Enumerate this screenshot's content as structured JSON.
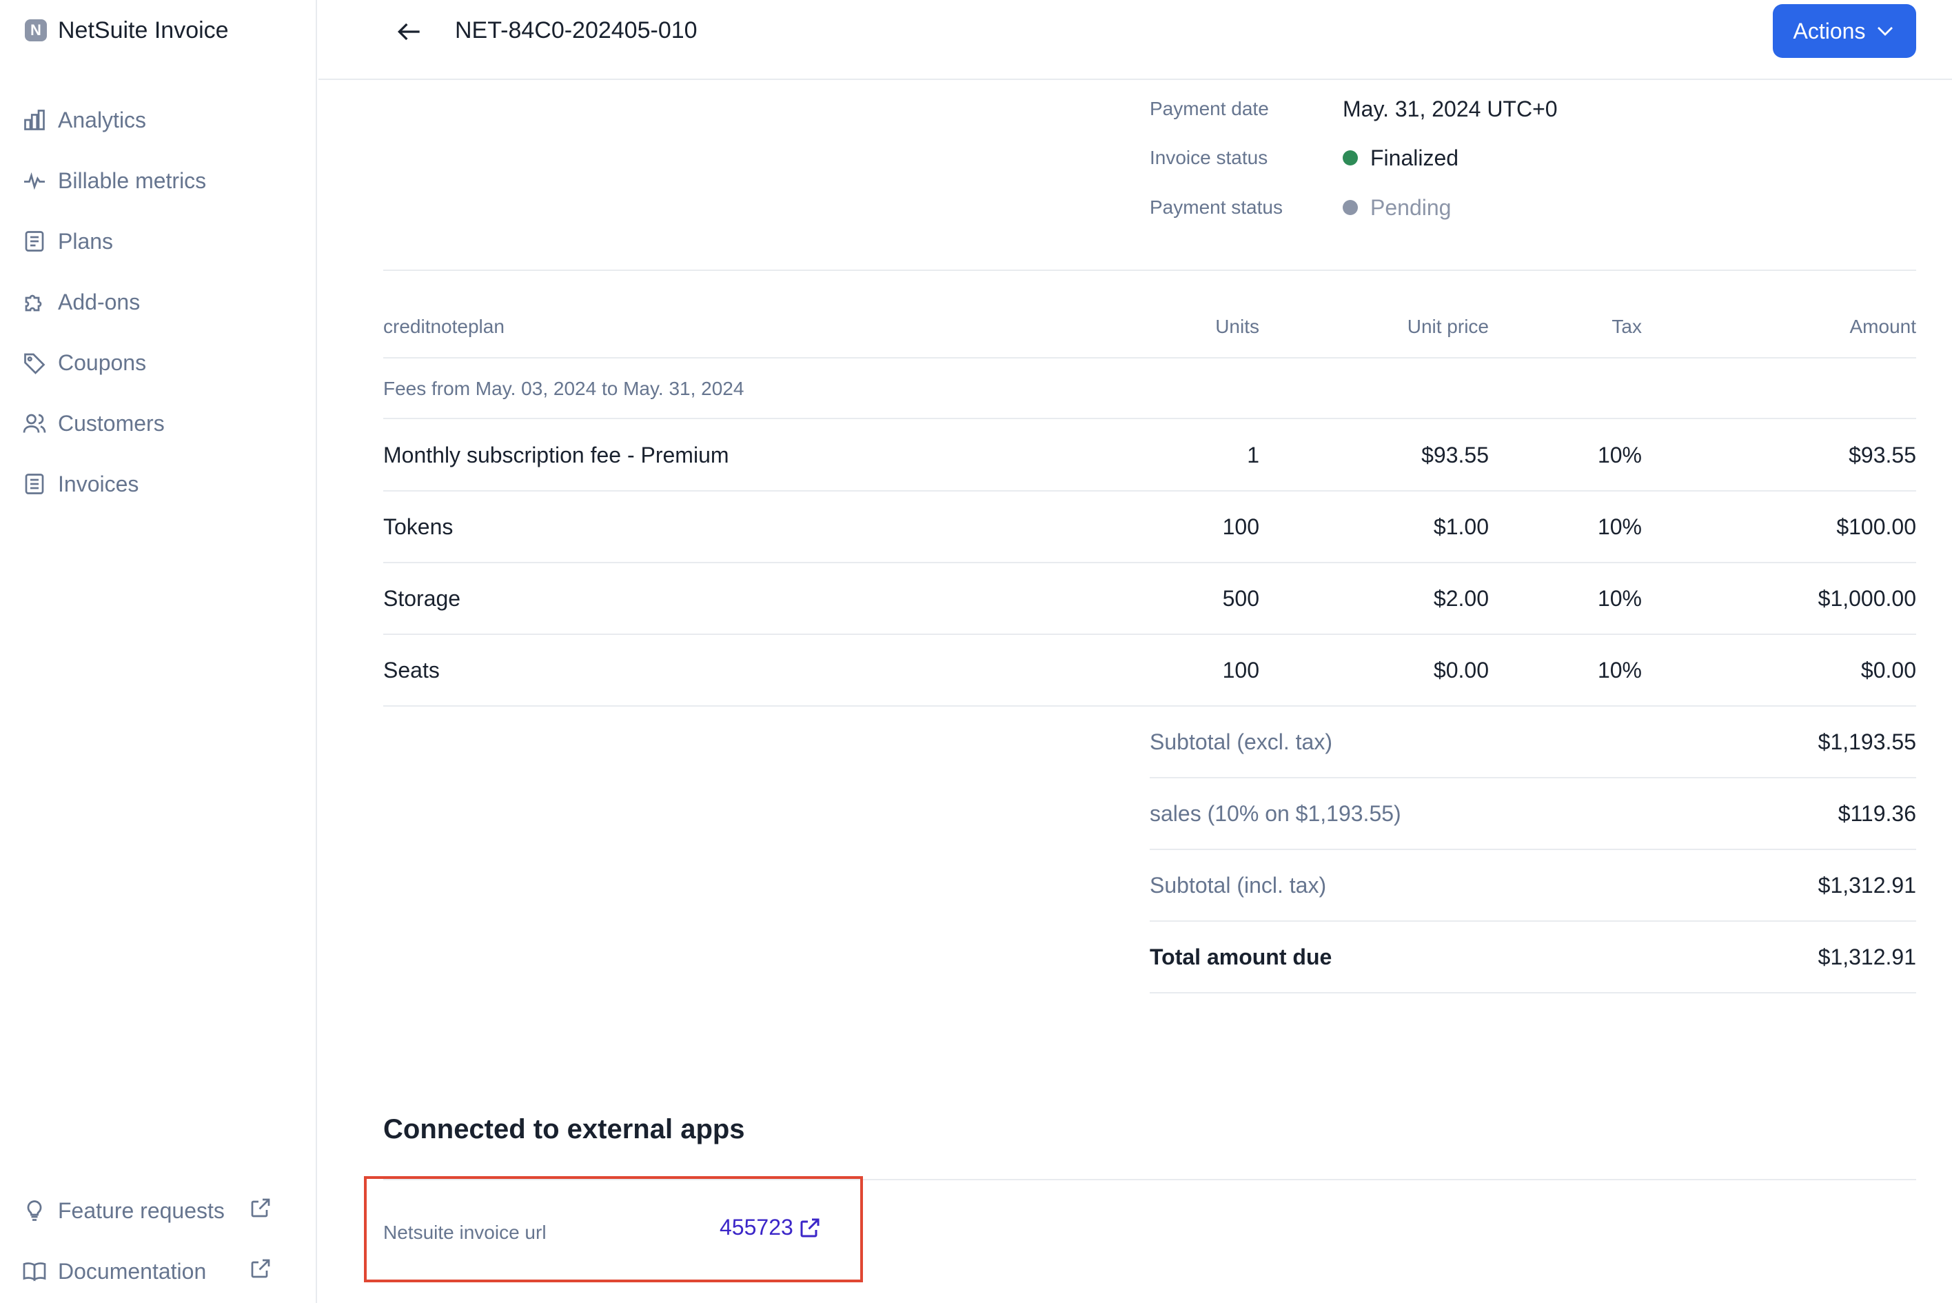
{
  "app": {
    "logo_letter": "N",
    "name": "NetSuite Invoice"
  },
  "nav": {
    "items": [
      {
        "label": "Analytics",
        "icon": "analytics-icon"
      },
      {
        "label": "Billable metrics",
        "icon": "pulse-icon"
      },
      {
        "label": "Plans",
        "icon": "clipboard-icon"
      },
      {
        "label": "Add-ons",
        "icon": "puzzle-icon"
      },
      {
        "label": "Coupons",
        "icon": "tag-icon"
      },
      {
        "label": "Customers",
        "icon": "users-icon"
      },
      {
        "label": "Invoices",
        "icon": "document-icon"
      }
    ],
    "bottom": [
      {
        "label": "Feature requests",
        "icon": "lightbulb-icon"
      },
      {
        "label": "Documentation",
        "icon": "book-icon"
      }
    ]
  },
  "header": {
    "title": "NET-84C0-202405-010",
    "actions_label": "Actions"
  },
  "info": {
    "payment_date_label": "Payment date",
    "payment_date_value": "May. 31, 2024 UTC+0",
    "invoice_status_label": "Invoice status",
    "invoice_status_value": "Finalized",
    "payment_status_label": "Payment status",
    "payment_status_value": "Pending",
    "colors": {
      "finalized": "#2e8b57",
      "pending": "#8c95a8"
    }
  },
  "table": {
    "headers": {
      "plan": "creditnoteplan",
      "units": "Units",
      "unit_price": "Unit price",
      "tax": "Tax",
      "amount": "Amount"
    },
    "fees_period": "Fees from May. 03, 2024 to May. 31, 2024",
    "rows": [
      {
        "name": "Monthly subscription fee - Premium",
        "units": "1",
        "unit_price": "$93.55",
        "tax": "10%",
        "amount": "$93.55"
      },
      {
        "name": "Tokens",
        "units": "100",
        "unit_price": "$1.00",
        "tax": "10%",
        "amount": "$100.00"
      },
      {
        "name": "Storage",
        "units": "500",
        "unit_price": "$2.00",
        "tax": "10%",
        "amount": "$1,000.00"
      },
      {
        "name": "Seats",
        "units": "100",
        "unit_price": "$0.00",
        "tax": "10%",
        "amount": "$0.00"
      }
    ]
  },
  "totals": {
    "subtotal_excl_label": "Subtotal (excl. tax)",
    "subtotal_excl_value": "$1,193.55",
    "sales_label": "sales (10% on $1,193.55)",
    "sales_value": "$119.36",
    "subtotal_incl_label": "Subtotal (incl. tax)",
    "subtotal_incl_value": "$1,312.91",
    "total_due_label": "Total amount due",
    "total_due_value": "$1,312.91"
  },
  "external": {
    "title": "Connected to external apps",
    "netsuite_label": "Netsuite invoice url",
    "netsuite_value": "455723"
  }
}
